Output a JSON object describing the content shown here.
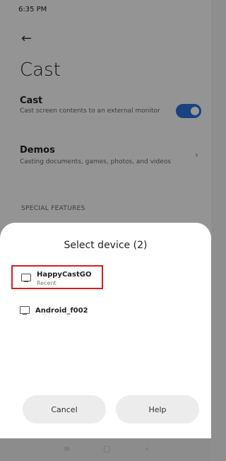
{
  "status_bar": {
    "left": "6:35 PM",
    "right": ""
  },
  "page": {
    "back_icon": "back-arrow-icon",
    "title": "Cast",
    "cast_row": {
      "title": "Cast",
      "subtitle": "Cast screen contents to an external monitor",
      "toggle_on": true
    },
    "demos_row": {
      "title": "Demos",
      "subtitle": "Casting documents, games, photos, and videos"
    },
    "section_label": "SPECIAL FEATURES"
  },
  "sheet": {
    "title": "Select device (2)",
    "devices": [
      {
        "name": "HappyCastGO",
        "status": "Recent",
        "icon": "monitor-icon",
        "highlighted": true
      },
      {
        "name": "Android_f002",
        "status": "",
        "icon": "monitor-icon",
        "highlighted": false
      }
    ],
    "cancel_label": "Cancel",
    "help_label": "Help"
  },
  "nav_bar": {
    "icons": [
      "menu-icon",
      "home-icon",
      "back-icon"
    ]
  },
  "colors": {
    "accent": "#2b6fd6",
    "highlight": "#d81e1e"
  }
}
